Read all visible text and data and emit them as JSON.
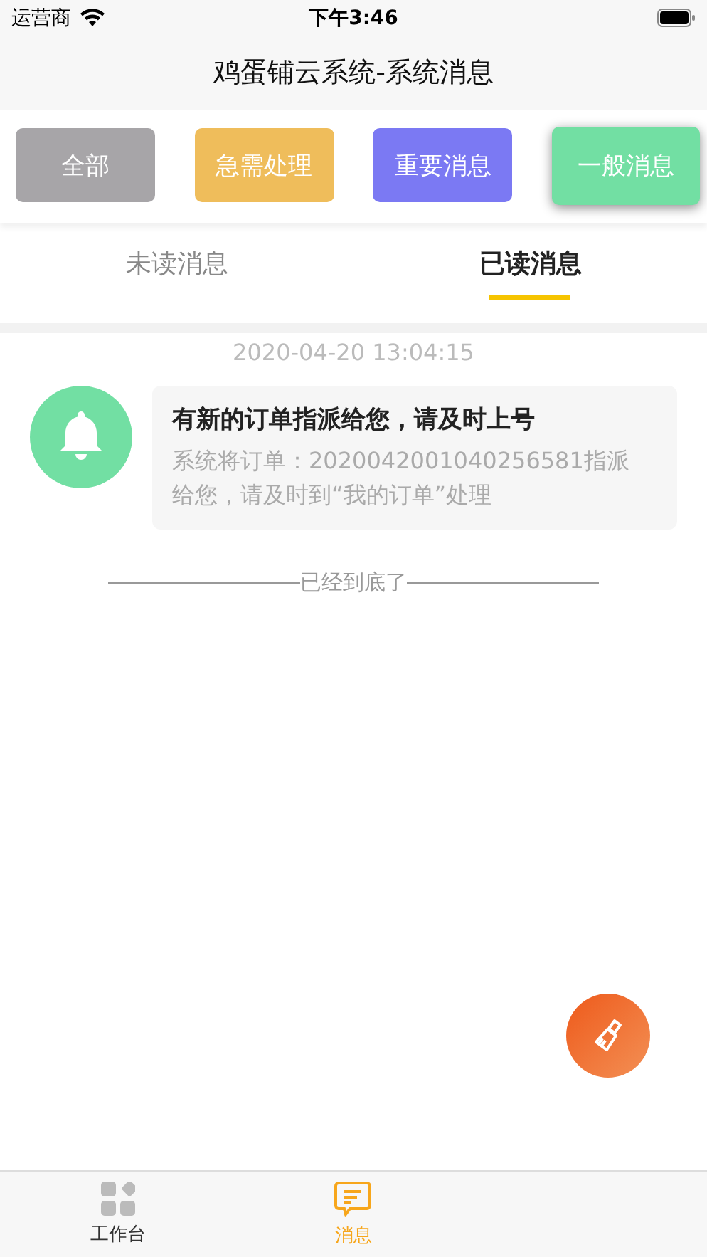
{
  "status_bar": {
    "carrier": "运营商",
    "time": "下午3:46"
  },
  "nav_bar": {
    "title": "鸡蛋铺云系统-系统消息"
  },
  "filters": [
    {
      "label": "全部",
      "color": "#a7a5a8",
      "selected": false
    },
    {
      "label": "急需处理",
      "color": "#efbd5b",
      "selected": false
    },
    {
      "label": "重要消息",
      "color": "#7b79f3",
      "selected": false
    },
    {
      "label": "一般消息",
      "color": "#72dfa3",
      "selected": true
    }
  ],
  "tabs": [
    {
      "label": "未读消息",
      "selected": false
    },
    {
      "label": "已读消息",
      "selected": true
    }
  ],
  "messages": [
    {
      "time": "2020-04-20 13:04:15",
      "title": "有新的订单指派给您，请及时上号",
      "body": "系统将订单：2020042001040256581指派给您，请及时到“我的订单”处理"
    }
  ],
  "end_note": "已经到底了",
  "tab_bar": [
    {
      "label": "工作台",
      "kind": "grid",
      "selected": false
    },
    {
      "label": "消息",
      "kind": "message",
      "selected": true
    }
  ]
}
